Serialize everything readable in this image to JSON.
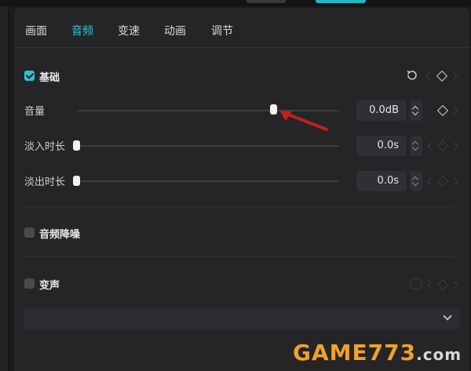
{
  "tabs": [
    {
      "label": "画面",
      "active": false
    },
    {
      "label": "音频",
      "active": true
    },
    {
      "label": "变速",
      "active": false
    },
    {
      "label": "动画",
      "active": false
    },
    {
      "label": "调节",
      "active": false
    }
  ],
  "basic_section": {
    "label": "基础",
    "checked": true
  },
  "volume": {
    "label": "音量",
    "value": "0.0dB",
    "level_fraction": 0.75
  },
  "fade_in": {
    "label": "淡入时长",
    "value": "0.0s",
    "level_fraction": 0.0
  },
  "fade_out": {
    "label": "淡出时长",
    "value": "0.0s",
    "level_fraction": 0.0
  },
  "noise_reduction": {
    "label": "音频降噪",
    "checked": false
  },
  "voice_change": {
    "label": "变声",
    "checked": false
  },
  "watermark": {
    "text_main": "GAME773",
    "text_suffix": ".com"
  },
  "colors": {
    "accent": "#2ec4d2",
    "annotation_arrow": "#c0201c"
  }
}
